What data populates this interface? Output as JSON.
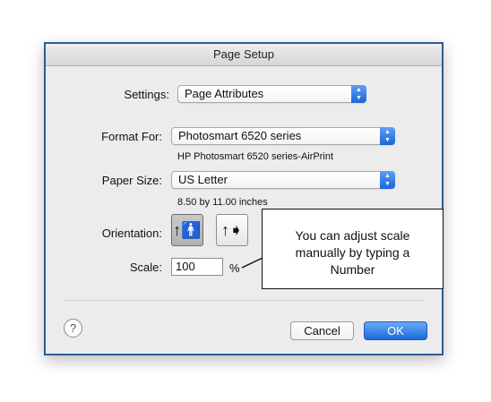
{
  "window": {
    "title": "Page Setup"
  },
  "settings": {
    "label": "Settings:",
    "value": "Page Attributes"
  },
  "format_for": {
    "label": "Format For:",
    "value": "Photosmart 6520 series",
    "subtitle": "HP Photosmart 6520 series-AirPrint"
  },
  "paper_size": {
    "label": "Paper Size:",
    "value": "US Letter",
    "subtitle": "8.50 by 11.00 inches"
  },
  "orientation": {
    "label": "Orientation:",
    "options": [
      "portrait",
      "landscape"
    ],
    "selected": "portrait"
  },
  "scale": {
    "label": "Scale:",
    "value": "100",
    "unit": "%"
  },
  "buttons": {
    "help": "?",
    "cancel": "Cancel",
    "ok": "OK"
  },
  "annotation": {
    "lines": [
      "You can adjust scale",
      "manually by typing a",
      "Number"
    ]
  },
  "colors": {
    "frame_border": "#2c5d93",
    "accent_blue": "#1c68dd",
    "dialog_bg": "#ececec"
  }
}
